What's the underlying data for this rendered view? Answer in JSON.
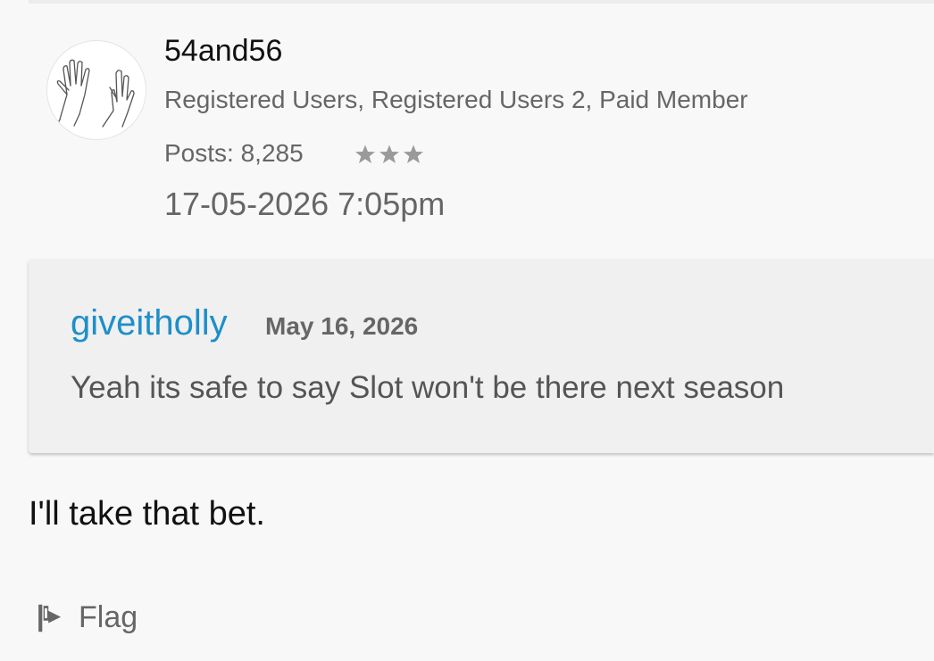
{
  "post": {
    "author": {
      "username": "54and56",
      "roles": "Registered Users, Registered Users 2, Paid Member",
      "posts": "Posts: 8,285",
      "rank_stars": 3,
      "avatar_icon": "hands-drawing-avatar"
    },
    "date": "17-05-2026 7:05pm",
    "quote": {
      "author": "giveitholly",
      "date": "May 16, 2026",
      "text": "Yeah its safe to say Slot won't be there next season"
    },
    "body": "I'll take that bet.",
    "actions": {
      "flag_label": "Flag",
      "flag_icon": "flag-icon"
    }
  },
  "colors": {
    "background": "#f8f8f8",
    "quote_background": "#f0f0f0",
    "link": "#1e8fc9",
    "muted_text": "#666666",
    "body_text": "#111111"
  }
}
